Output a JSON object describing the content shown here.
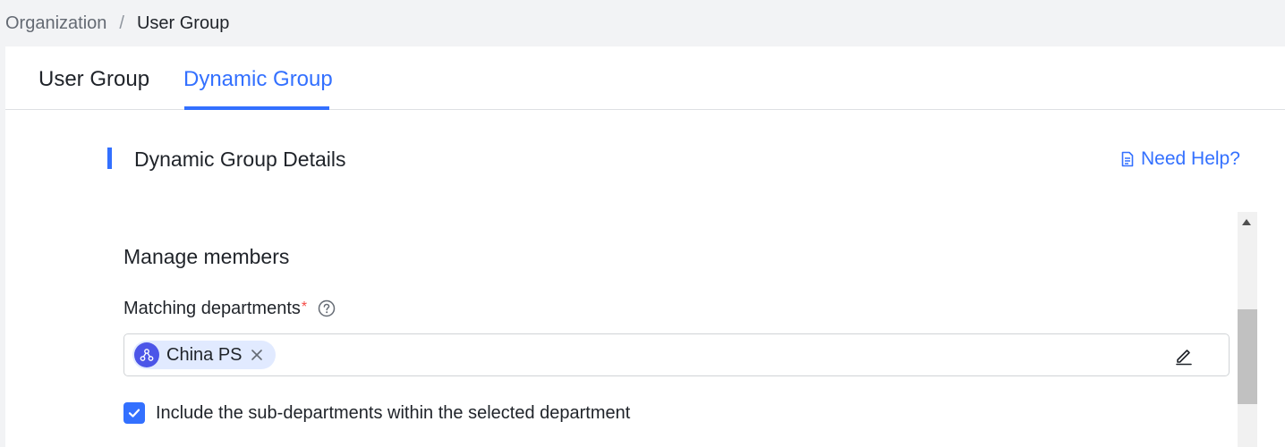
{
  "breadcrumb": {
    "parent": "Organization",
    "separator": "/",
    "current": "User Group"
  },
  "tabs": [
    {
      "label": "User Group",
      "active": false
    },
    {
      "label": "Dynamic Group",
      "active": true
    }
  ],
  "section": {
    "title": "Dynamic Group Details",
    "help_link": "Need Help?",
    "help_icon": "document-icon"
  },
  "manage_members": {
    "title": "Manage members",
    "matching_departments": {
      "label": "Matching departments",
      "required_mark": "*",
      "help_icon": "question-circle-icon",
      "tags": [
        {
          "label": "China PS",
          "icon": "org-structure-icon"
        }
      ],
      "edit_icon": "pencil-icon"
    },
    "include_sub_departments": {
      "label": "Include the sub-departments within the selected department",
      "checked": true
    }
  },
  "colors": {
    "accent": "#3370ff",
    "required": "#f54a45",
    "tag_background": "#e1eaff",
    "tag_avatar": "#4b55e8"
  }
}
